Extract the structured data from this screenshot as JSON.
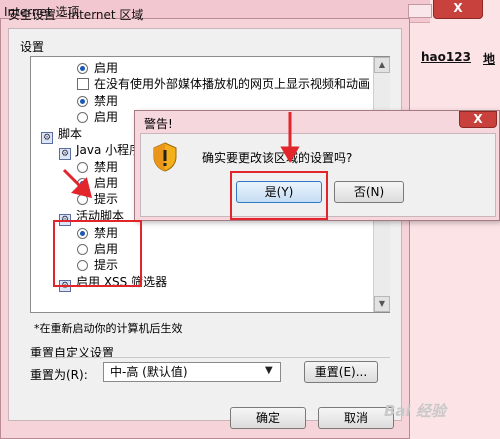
{
  "background": {
    "window_title": "Internet 选项",
    "close_glyph": "X",
    "links": [
      "hao123",
      "地"
    ]
  },
  "security_dialog": {
    "title": "安全设置 - Internet 区域",
    "settings_label": "设置",
    "items": [
      {
        "type": "radio",
        "label": "启用",
        "selected": true
      },
      {
        "type": "checkbox",
        "label": "在没有使用外部媒体播放机的网页上显示视频和动画",
        "checked": false
      },
      {
        "type": "radio",
        "label": "禁用",
        "selected": true
      },
      {
        "type": "radio",
        "label": "启用",
        "selected": false
      },
      {
        "type": "category",
        "label": "脚本"
      },
      {
        "type": "category",
        "label": "Java 小程序"
      },
      {
        "type": "radio",
        "label": "禁用",
        "selected": false
      },
      {
        "type": "radio",
        "label": "启用",
        "selected": true
      },
      {
        "type": "radio",
        "label": "提示",
        "selected": false
      },
      {
        "type": "category",
        "label": "活动脚本"
      },
      {
        "type": "radio",
        "label": "禁用",
        "selected": true
      },
      {
        "type": "radio",
        "label": "启用",
        "selected": false
      },
      {
        "type": "radio",
        "label": "提示",
        "selected": false
      },
      {
        "type": "category",
        "label": "启用 XSS 筛选器"
      }
    ],
    "restart_note": "*在重新启动你的计算机后生效",
    "reset_group_title": "重置自定义设置",
    "reset_label": "重置为(R):",
    "reset_value": "中-高 (默认值)",
    "reset_button": "重置(E)...",
    "ok_button": "确定",
    "cancel_button": "取消"
  },
  "warning_dialog": {
    "title": "警告!",
    "message": "确实要更改该区域的设置吗?",
    "yes_button": "是(Y)",
    "no_button": "否(N)",
    "close_glyph": "X"
  },
  "watermark": "Bai 经验",
  "colors": {
    "annotation": "#e2242b",
    "title_bar": "#f3c7cf",
    "close_red": "#c8413d",
    "radio_dot": "#1b58b3"
  }
}
